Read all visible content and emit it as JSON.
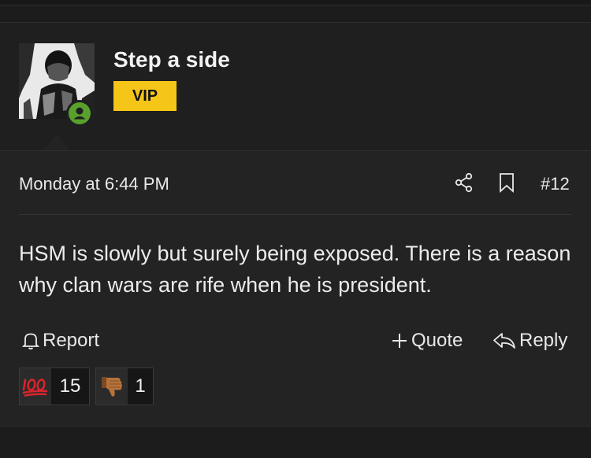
{
  "post": {
    "author": "Step a side",
    "badge": "VIP",
    "timestamp": "Monday at 6:44 PM",
    "post_number": "#12",
    "body": "HSM is slowly but surely being exposed. There is a reason why clan wars are rife when he is president.",
    "actions": {
      "report": "Report",
      "quote": "Quote",
      "reply": "Reply"
    },
    "reactions": [
      {
        "icon": "hundred-points-icon",
        "count": "15"
      },
      {
        "icon": "thumbs-down-icon",
        "count": "1"
      }
    ]
  },
  "colors": {
    "badge_bg": "#f5c518",
    "online_status": "#5aa02c",
    "background": "#232323"
  }
}
